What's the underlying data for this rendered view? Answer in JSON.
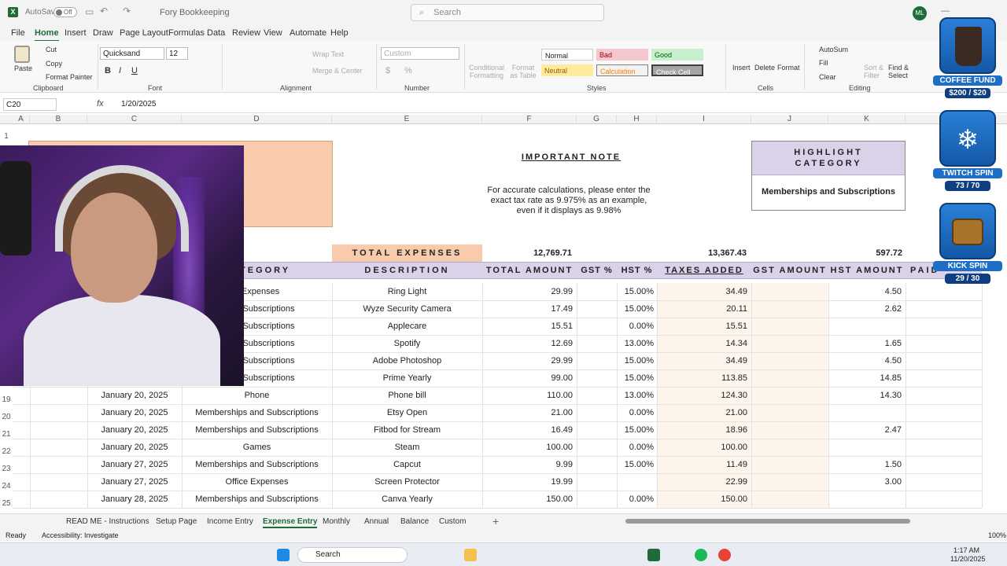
{
  "titlebar": {
    "autosave": "AutoSave",
    "autosave_state": "Off",
    "filename": "Fory Bookkeeping",
    "search_placeholder": "Search",
    "user_initials": "ML"
  },
  "menu_tabs": [
    "File",
    "Home",
    "Insert",
    "Draw",
    "Page Layout",
    "Formulas",
    "Data",
    "Review",
    "View",
    "Automate",
    "Help"
  ],
  "ribbon": {
    "paste": "Paste",
    "cut": "Cut",
    "copy": "Copy",
    "format_painter": "Format Painter",
    "font_name": "Quicksand",
    "font_size": "12",
    "wrap_text": "Wrap Text",
    "merge_center": "Merge & Center",
    "number_format": "Custom",
    "cond_format": "Conditional Formatting",
    "format_table": "Format as Table",
    "styles": {
      "normal": "Normal",
      "bad": "Bad",
      "good": "Good",
      "neutral": "Neutral",
      "calculation": "Calculation",
      "check_cell": "Check Cell"
    },
    "insert": "Insert",
    "delete": "Delete",
    "format": "Format",
    "autosum": "AutoSum",
    "fill": "Fill",
    "clear": "Clear",
    "sort_filter": "Sort & Filter",
    "find_select": "Find & Select",
    "groups": {
      "clipboard": "Clipboard",
      "font": "Font",
      "alignment": "Alignment",
      "number": "Number",
      "styles": "Styles",
      "cells": "Cells",
      "editing": "Editing"
    }
  },
  "formula_bar": {
    "name_box": "C20",
    "fx": "fx",
    "value": "1/20/2025"
  },
  "columns": [
    "A",
    "B",
    "C",
    "D",
    "E",
    "F",
    "G",
    "H",
    "I",
    "J",
    "K"
  ],
  "row_numbers": [
    "1",
    "19",
    "20",
    "21",
    "22",
    "23",
    "24",
    "25"
  ],
  "note": {
    "title": "IMPORTANT NOTE",
    "body": "For accurate calculations, please enter the exact tax rate as 9.975% as an example, even if it displays as 9.98%"
  },
  "highlight": {
    "title": "HIGHLIGHT CATEGORY",
    "value": "Memberships and Subscriptions"
  },
  "totals": {
    "label": "TOTAL EXPENSES",
    "total_amount": "12,769.71",
    "taxes_added": "13,367.43",
    "hst_amount": "597.72"
  },
  "headers": {
    "category": "CATEGORY",
    "description": "DESCRIPTION",
    "total_amount": "TOTAL AMOUNT",
    "gst_pct": "GST %",
    "hst_pct": "HST %",
    "taxes_added": "TAXES ADDED",
    "gst_amount": "GST AMOUNT",
    "hst_amount": "HST AMOUNT",
    "paid": "PAID"
  },
  "rows": [
    {
      "date": "",
      "category": "e Expenses",
      "description": "Ring Light",
      "total": "29.99",
      "gst": "",
      "hst": "15.00%",
      "taxes": "34.49",
      "gst_amt": "",
      "hst_amt": "4.50"
    },
    {
      "date": "",
      "category": "s and Subscriptions",
      "description": "Wyze Security Camera",
      "total": "17.49",
      "gst": "",
      "hst": "15.00%",
      "taxes": "20.11",
      "gst_amt": "",
      "hst_amt": "2.62"
    },
    {
      "date": "",
      "category": "s and Subscriptions",
      "description": "Applecare",
      "total": "15.51",
      "gst": "",
      "hst": "0.00%",
      "taxes": "15.51",
      "gst_amt": "",
      "hst_amt": ""
    },
    {
      "date": "",
      "category": "s and Subscriptions",
      "description": "Spotify",
      "total": "12.69",
      "gst": "",
      "hst": "13.00%",
      "taxes": "14.34",
      "gst_amt": "",
      "hst_amt": "1.65"
    },
    {
      "date": "",
      "category": "s and Subscriptions",
      "description": "Adobe Photoshop",
      "total": "29.99",
      "gst": "",
      "hst": "15.00%",
      "taxes": "34.49",
      "gst_amt": "",
      "hst_amt": "4.50"
    },
    {
      "date": "",
      "category": "s and Subscriptions",
      "description": "Prime Yearly",
      "total": "99.00",
      "gst": "",
      "hst": "15.00%",
      "taxes": "113.85",
      "gst_amt": "",
      "hst_amt": "14.85"
    },
    {
      "date": "January 20, 2025",
      "category": "Phone",
      "description": "Phone bill",
      "total": "110.00",
      "gst": "",
      "hst": "13.00%",
      "taxes": "124.30",
      "gst_amt": "",
      "hst_amt": "14.30"
    },
    {
      "date": "January 20, 2025",
      "category": "Memberships and Subscriptions",
      "description": "Etsy Open",
      "total": "21.00",
      "gst": "",
      "hst": "0.00%",
      "taxes": "21.00",
      "gst_amt": "",
      "hst_amt": ""
    },
    {
      "date": "January 20, 2025",
      "category": "Memberships and Subscriptions",
      "description": "Fitbod for Stream",
      "total": "16.49",
      "gst": "",
      "hst": "15.00%",
      "taxes": "18.96",
      "gst_amt": "",
      "hst_amt": "2.47"
    },
    {
      "date": "January 20, 2025",
      "category": "Games",
      "description": "Steam",
      "total": "100.00",
      "gst": "",
      "hst": "0.00%",
      "taxes": "100.00",
      "gst_amt": "",
      "hst_amt": ""
    },
    {
      "date": "January 27, 2025",
      "category": "Memberships and Subscriptions",
      "description": "Capcut",
      "total": "9.99",
      "gst": "",
      "hst": "15.00%",
      "taxes": "11.49",
      "gst_amt": "",
      "hst_amt": "1.50"
    },
    {
      "date": "January 27, 2025",
      "category": "Office Expenses",
      "description": "Screen Protector",
      "total": "19.99",
      "gst": "",
      "hst": "",
      "taxes": "22.99",
      "gst_amt": "",
      "hst_amt": "3.00"
    },
    {
      "date": "January 28, 2025",
      "category": "Memberships and Subscriptions",
      "description": "Canva Yearly",
      "total": "150.00",
      "gst": "",
      "hst": "0.00%",
      "taxes": "150.00",
      "gst_amt": "",
      "hst_amt": ""
    }
  ],
  "sheet_tabs": [
    "READ ME - Instructions",
    "Setup Page",
    "Income Entry",
    "Expense Entry",
    "Monthly",
    "Annual",
    "Balance",
    "Custom"
  ],
  "active_sheet": "Expense Entry",
  "status": {
    "ready": "Ready",
    "accessibility": "Accessibility: Investigate",
    "zoom": "100%"
  },
  "taskbar": {
    "search": "Search",
    "time": "1:17 AM",
    "date": "11/20/2025"
  },
  "overlays": [
    {
      "title": "COFFEE FUND",
      "count": "$200 / $20"
    },
    {
      "title": "TWITCH SPIN",
      "count": "73 / 70"
    },
    {
      "title": "KICK SPIN",
      "count": "29 / 30"
    }
  ],
  "colors": {
    "accent": "#1f6b3a",
    "header_purple": "#d9d2e9",
    "peach": "#f9cbad",
    "tan": "#fdf4ec"
  }
}
